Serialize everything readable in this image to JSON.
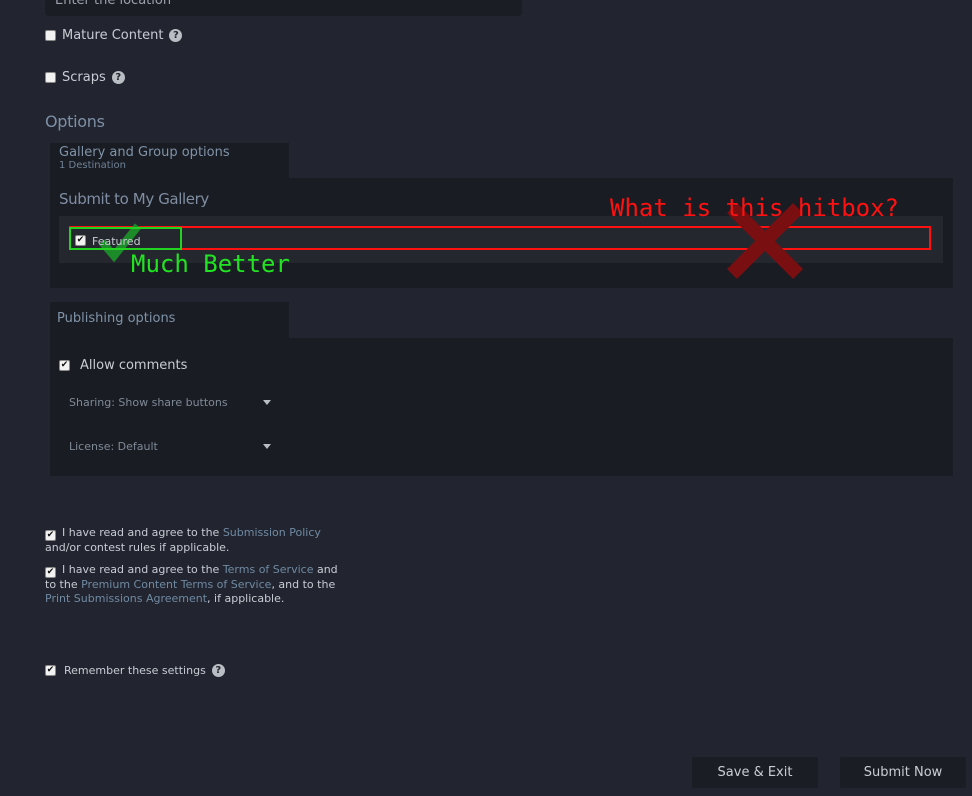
{
  "location": {
    "placeholder": "Enter the location"
  },
  "content_flags": [
    {
      "label": "Mature Content",
      "checked": false
    },
    {
      "label": "Scraps",
      "checked": false
    }
  ],
  "options": {
    "title": "Options",
    "gallery_tab": {
      "title": "Gallery and Group options",
      "subtitle": "1 Destination"
    },
    "gallery_panel": {
      "title": "Submit to My Gallery",
      "featured_label": "Featured",
      "featured_checked": true
    },
    "publishing_tab": {
      "title": "Publishing options"
    },
    "publishing_panel": {
      "allow_comments_label": "Allow comments",
      "allow_comments_checked": true,
      "sharing_label": "Sharing: Show share buttons",
      "license_label": "License: Default"
    }
  },
  "agreements": {
    "policy": {
      "prefix": "I have read and agree to the ",
      "link": "Submission Policy",
      "suffix": "and/or contest rules if applicable."
    },
    "terms": {
      "prefix": "I have read and agree to the ",
      "tos_link": "Terms of Service",
      "and1": " and",
      "to_the": "to the ",
      "premium_link": "Premium Content Terms of Service",
      "and2": ", and to the",
      "print_link": "Print Submissions Agreement",
      "suffix": ", if applicable."
    }
  },
  "remember": {
    "label": "Remember these settings",
    "checked": true
  },
  "buttons": {
    "save_exit": "Save & Exit",
    "submit_now": "Submit Now"
  },
  "annotations": {
    "bad_label": "What is this hitbox?",
    "good_label": "Much Better",
    "bad_color": "#ff1111",
    "good_color": "#22e322"
  }
}
